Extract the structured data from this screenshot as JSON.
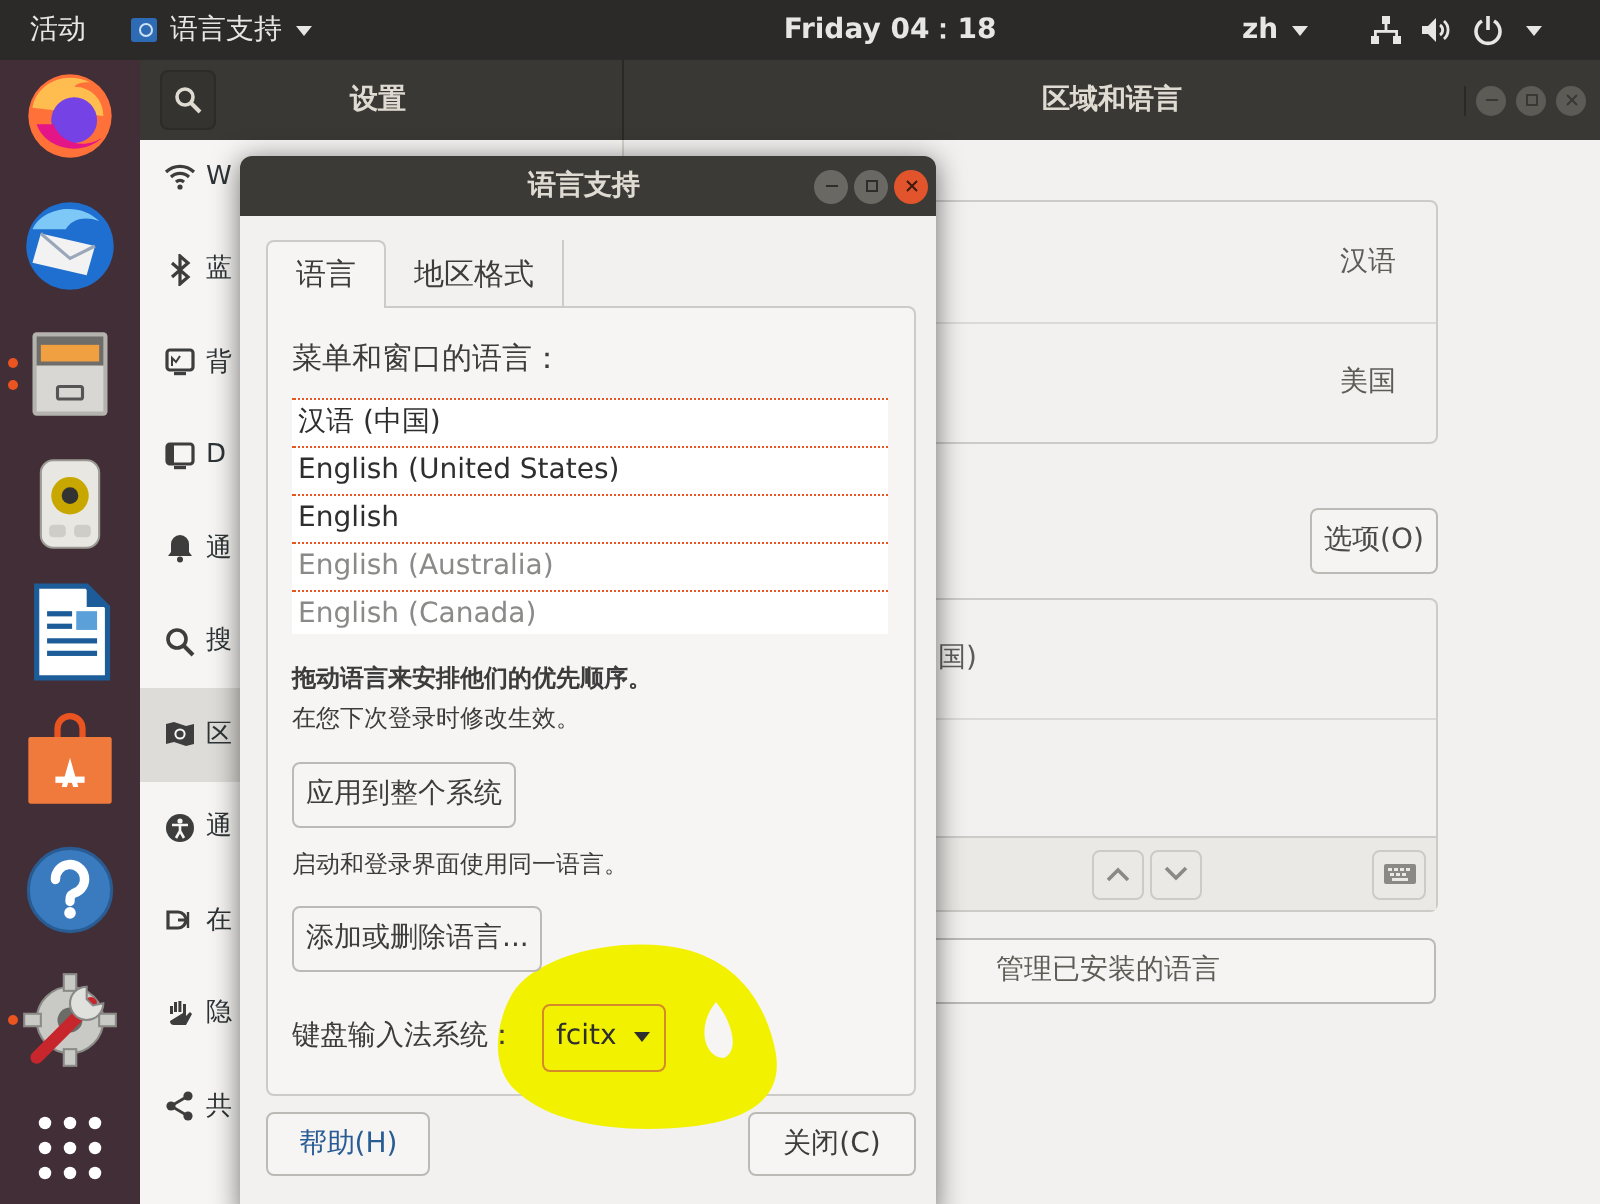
{
  "top_bar": {
    "activities": "活动",
    "app_menu": "语言支持",
    "clock": "Friday 04：18",
    "input_method": "zh"
  },
  "dock": [
    {
      "kind": "firefox",
      "running": false
    },
    {
      "kind": "mail",
      "running": false
    },
    {
      "kind": "files",
      "running": true,
      "multiple_windows": true
    },
    {
      "kind": "music",
      "running": false
    },
    {
      "kind": "writer",
      "running": false
    },
    {
      "kind": "software",
      "running": false
    },
    {
      "kind": "help",
      "running": false
    },
    {
      "kind": "settings",
      "running": true,
      "multiple_windows": false
    },
    {
      "kind": "apps",
      "running": false
    }
  ],
  "settings": {
    "title": "设置",
    "panel_title": "区域和语言",
    "sidebar": [
      {
        "kind": "wifi",
        "label": "W",
        "selected": false
      },
      {
        "kind": "bluetooth",
        "label": "蓝",
        "selected": false
      },
      {
        "kind": "background",
        "label": "背",
        "selected": false
      },
      {
        "kind": "dock",
        "label": "D",
        "selected": false
      },
      {
        "kind": "notifications",
        "label": "通",
        "selected": false
      },
      {
        "kind": "search",
        "label": "搜",
        "selected": false
      },
      {
        "kind": "region",
        "label": "区",
        "selected": true
      },
      {
        "kind": "accessibility",
        "label": "通",
        "selected": false
      },
      {
        "kind": "online",
        "label": "在",
        "selected": false
      },
      {
        "kind": "privacy",
        "label": "隐",
        "selected": false
      },
      {
        "kind": "sharing",
        "label": "共",
        "selected": false
      }
    ],
    "language_rows": [
      {
        "value": "汉语"
      },
      {
        "value": "美国"
      }
    ],
    "options_button": "选项(O)",
    "input_sources": [
      {
        "label": "国)"
      }
    ],
    "manage_button": "管理已安装的语言"
  },
  "dialog": {
    "title": "语言支持",
    "tabs": [
      {
        "label": "语言",
        "selected": true
      },
      {
        "label": "地区格式",
        "selected": false
      }
    ],
    "languages_heading": "菜单和窗口的语言：",
    "languages": [
      {
        "label": "汉语 (中国)",
        "dimmed": false
      },
      {
        "label": "English (United States)",
        "dimmed": false
      },
      {
        "label": "English",
        "dimmed": false
      },
      {
        "label": "English (Australia)",
        "dimmed": true
      },
      {
        "label": "English (Canada)",
        "dimmed": true
      }
    ],
    "drag_hint": "拖动语言来安排他们的优先顺序。",
    "effect_note": "在您下次登录时修改生效。",
    "apply_button": "应用到整个系统",
    "login_note": "启动和登录界面使用同一语言。",
    "add_remove_button": "添加或删除语言...",
    "im_label": "键盘输入法系统：",
    "im_value": "fcitx",
    "help_button": "帮助(H)",
    "close_button": "关闭(C)"
  }
}
